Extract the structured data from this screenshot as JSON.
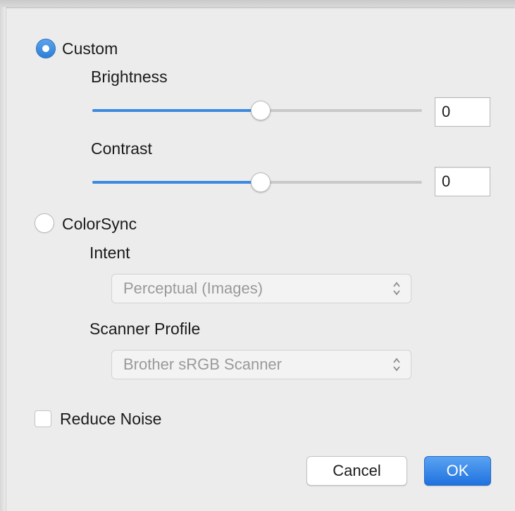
{
  "custom": {
    "label": "Custom",
    "selected": true
  },
  "brightness": {
    "label": "Brightness",
    "value": "0",
    "slider_fraction": 0.51
  },
  "contrast": {
    "label": "Contrast",
    "value": "0",
    "slider_fraction": 0.51
  },
  "colorsync": {
    "label": "ColorSync",
    "selected": false
  },
  "intent": {
    "label": "Intent",
    "selected": "Perceptual (Images)"
  },
  "scanner_profile": {
    "label": "Scanner Profile",
    "selected": "Brother sRGB Scanner"
  },
  "reduce_noise": {
    "label": "Reduce Noise",
    "checked": false
  },
  "buttons": {
    "cancel": "Cancel",
    "ok": "OK"
  },
  "colors": {
    "accent": "#3b89e0",
    "ok_button": "#2f7fe6"
  }
}
